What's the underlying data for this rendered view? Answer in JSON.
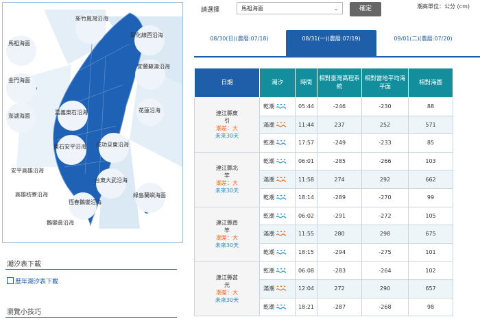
{
  "map": {
    "regions": [
      "新竹鳳灣沿海",
      "彰化線西沿海",
      "馬祖海面",
      "金門海面",
      "澎湖海面",
      "宜蘭蘇澳沿海",
      "花蓮沿海",
      "嘉義東石沿海",
      "東石安平沿海",
      "成功旦東沿海",
      "安平高雄沿海",
      "高雄枋寮沿海",
      "台東大武沿海",
      "綠島蘭嶼海面",
      "恆春鵝鑾沿海",
      "鵝鑾鼻沿海"
    ]
  },
  "links": {
    "tide_download_title": "潮汐表下載",
    "history_download": "歷年潮汐表下載",
    "tips_title": "瀏覽小技巧"
  },
  "form": {
    "select_label": "請選擇",
    "selected_value": "馬祖海面",
    "confirm_label": "確定",
    "unit_text": "潮高單位：公分 (cm)"
  },
  "tabs": [
    {
      "label": "08/30(日)(農曆:07/18)",
      "active": false
    },
    {
      "label": "08/31(一)(農曆:07/19)",
      "active": true
    },
    {
      "label": "09/01(二)(農曆:07/20)",
      "active": false
    }
  ],
  "table": {
    "headers": [
      "日期",
      "潮汐",
      "時間",
      "相對臺灣高程系統",
      "相對當地平均海平面",
      "相對海圖"
    ],
    "groups": [
      {
        "location": "連江縣東引",
        "range": "潮差：大",
        "forecast": "未來30天",
        "rows": [
          {
            "tide": "乾潮",
            "type": "low",
            "time": "05:44",
            "twvd": "-246",
            "local": "-230",
            "chart": "88"
          },
          {
            "tide": "滿潮",
            "type": "high",
            "time": "11:44",
            "twvd": "237",
            "local": "252",
            "chart": "571"
          },
          {
            "tide": "乾潮",
            "type": "low",
            "time": "17:57",
            "twvd": "-249",
            "local": "-233",
            "chart": "85"
          }
        ]
      },
      {
        "location": "連江縣北竿",
        "range": "潮差：大",
        "forecast": "未來30天",
        "rows": [
          {
            "tide": "乾潮",
            "type": "low",
            "time": "06:01",
            "twvd": "-285",
            "local": "-266",
            "chart": "103"
          },
          {
            "tide": "滿潮",
            "type": "high",
            "time": "11:58",
            "twvd": "274",
            "local": "292",
            "chart": "662"
          },
          {
            "tide": "乾潮",
            "type": "low",
            "time": "18:14",
            "twvd": "-289",
            "local": "-270",
            "chart": "99"
          }
        ]
      },
      {
        "location": "連江縣南竿",
        "range": "潮差：大",
        "forecast": "未來30天",
        "rows": [
          {
            "tide": "乾潮",
            "type": "low",
            "time": "06:02",
            "twvd": "-291",
            "local": "-272",
            "chart": "105"
          },
          {
            "tide": "滿潮",
            "type": "high",
            "time": "11:55",
            "twvd": "280",
            "local": "298",
            "chart": "675"
          },
          {
            "tide": "乾潮",
            "type": "low",
            "time": "18:15",
            "twvd": "-294",
            "local": "-275",
            "chart": "101"
          }
        ]
      },
      {
        "location": "連江縣莒光",
        "range": "潮差：大",
        "forecast": "未來30天",
        "rows": [
          {
            "tide": "乾潮",
            "type": "low",
            "time": "06:08",
            "twvd": "-283",
            "local": "-264",
            "chart": "102"
          },
          {
            "tide": "滿潮",
            "type": "high",
            "time": "12:04",
            "twvd": "272",
            "local": "290",
            "chart": "657"
          },
          {
            "tide": "乾潮",
            "type": "low",
            "time": "18:21",
            "twvd": "-287",
            "local": "-268",
            "chart": "98"
          }
        ]
      }
    ]
  },
  "colors": {
    "primary": "#1f5ea8",
    "teal": "#138e9c",
    "low_icon": "#1f8fc8",
    "high_icon": "#e56b1f"
  }
}
